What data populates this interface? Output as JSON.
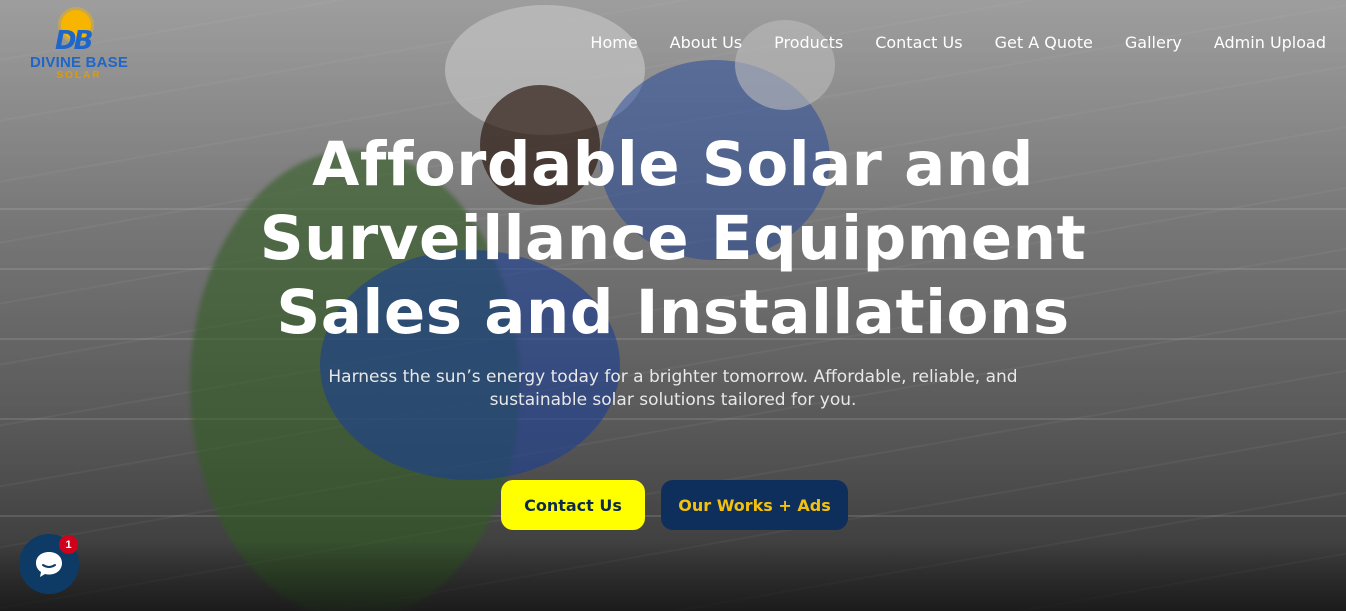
{
  "brand": {
    "logo_mark": "DB",
    "name": "DIVINE BASE",
    "sub": "SOLAR",
    "colors": {
      "blue": "#1e66c8",
      "sun": "#f7b500"
    }
  },
  "nav": {
    "items": [
      {
        "label": "Home"
      },
      {
        "label": "About Us"
      },
      {
        "label": "Products"
      },
      {
        "label": "Contact Us"
      },
      {
        "label": "Get A Quote"
      },
      {
        "label": "Gallery"
      },
      {
        "label": "Admin Upload"
      }
    ]
  },
  "hero": {
    "title_lines": [
      "Affordable Solar and",
      "Surveillance Equipment",
      "Sales and Installations"
    ],
    "subtitle": "Harness the sun’s energy today for a brighter tomorrow. Affordable, reliable, and sustainable solar solutions tailored for you.",
    "buttons": {
      "contact_label": "Contact Us",
      "works_label": "Our Works + Ads"
    },
    "colors": {
      "contact_bg": "#ffff00",
      "works_bg": "#0e2e5c",
      "works_text": "#f4c20d"
    }
  },
  "chat": {
    "icon": "chat-bubble-icon",
    "badge_count": "1"
  }
}
